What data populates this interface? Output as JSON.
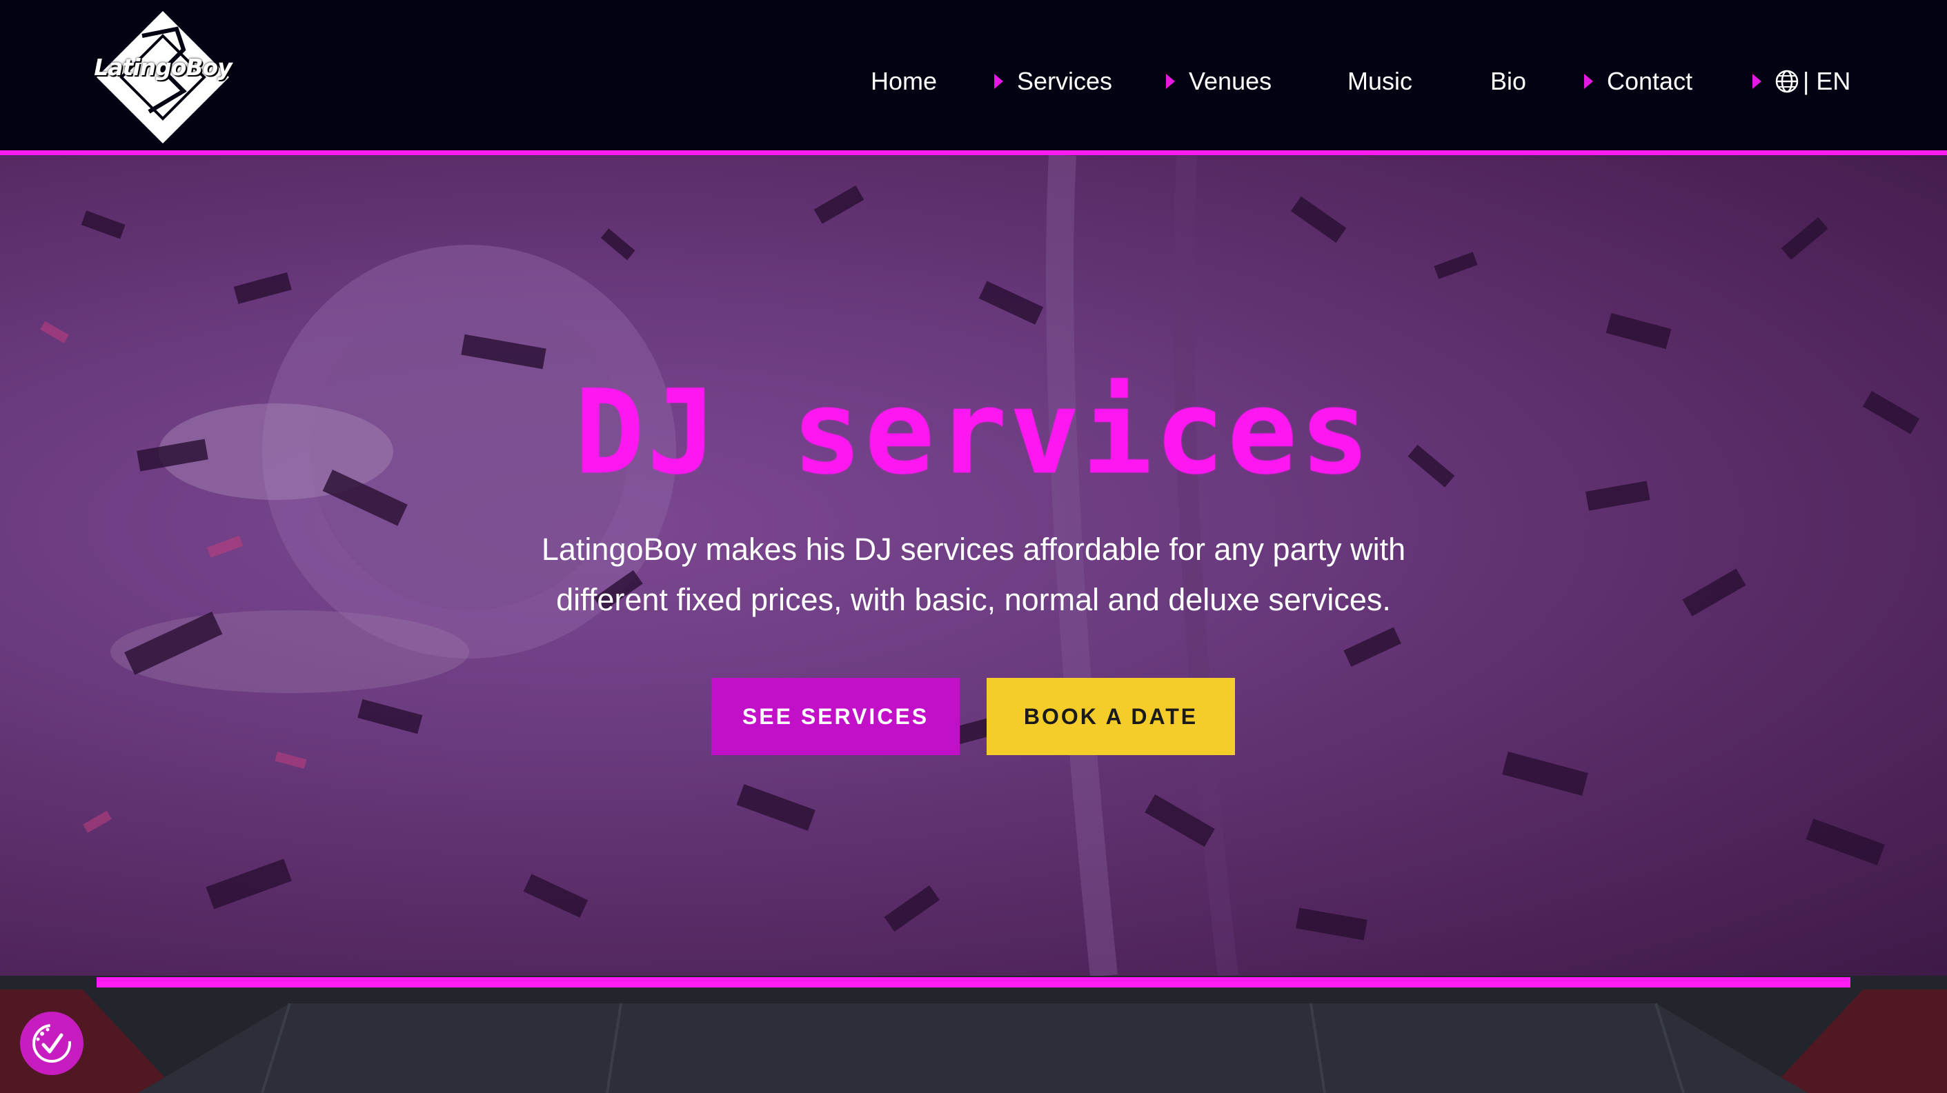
{
  "brand": {
    "logo_text": "LatingoBoy"
  },
  "nav": {
    "items": [
      {
        "label": "Home",
        "has_arrow": false
      },
      {
        "label": "Services",
        "has_arrow": true
      },
      {
        "label": "Venues",
        "has_arrow": true
      },
      {
        "label": "Music",
        "has_arrow": false
      },
      {
        "label": "Bio",
        "has_arrow": false
      },
      {
        "label": "Contact",
        "has_arrow": true
      }
    ],
    "language": {
      "label": "| EN",
      "icon": "globe-icon"
    }
  },
  "hero": {
    "title": "DJ services",
    "description_line1": "LatingoBoy makes his DJ services affordable for any party with",
    "description_line2": "different fixed prices, with basic, normal and deluxe services.",
    "primary_button": "SEE SERVICES",
    "secondary_button": "BOOK A DATE"
  },
  "colors": {
    "accent_pink": "#ff1cf2",
    "button_purple": "#c20fc8",
    "button_yellow": "#f4cd2a",
    "header_bg": "#020212"
  },
  "widgets": {
    "accessibility_icon": "accessibility-icon"
  }
}
